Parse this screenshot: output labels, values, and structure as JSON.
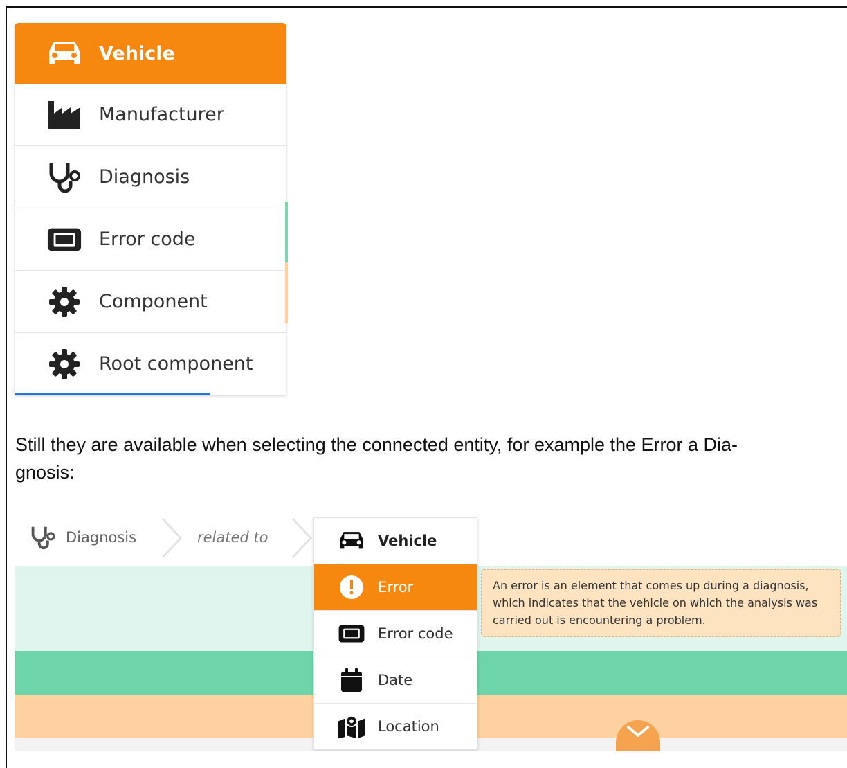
{
  "menu_top": {
    "items": [
      {
        "label": "Vehicle",
        "icon": "car-icon",
        "active": true
      },
      {
        "label": "Manufacturer",
        "icon": "factory-icon"
      },
      {
        "label": "Diagnosis",
        "icon": "stethoscope-icon"
      },
      {
        "label": "Error code",
        "icon": "ticket-icon"
      },
      {
        "label": "Component",
        "icon": "gear-icon"
      },
      {
        "label": "Root component",
        "icon": "gear-icon"
      }
    ]
  },
  "paragraph": {
    "line1": "Still they are available when selecting the connected entity, for example the Error a Dia-",
    "line2": "gnosis:"
  },
  "breadcrumb": {
    "root": "Diagnosis",
    "relation": "related to"
  },
  "menu_bottom": {
    "items": [
      {
        "label": "Vehicle",
        "icon": "car-icon"
      },
      {
        "label": "Error",
        "icon": "alert-circle-icon",
        "active": true
      },
      {
        "label": "Error code",
        "icon": "ticket-icon"
      },
      {
        "label": "Date",
        "icon": "calendar-icon"
      },
      {
        "label": "Location",
        "icon": "map-marker-icon"
      }
    ]
  },
  "tooltip": {
    "text": "An error is an element that comes up during a diagnosis, which indicates that the vehicle on which the analysis was carried out is encountering a problem."
  },
  "colors": {
    "accent": "#f6870f",
    "band_light_green": "#e1f5ef",
    "band_green": "#6dd5a9",
    "band_peach": "#ffd0a0",
    "scroll_blue": "#1f7ae0"
  }
}
